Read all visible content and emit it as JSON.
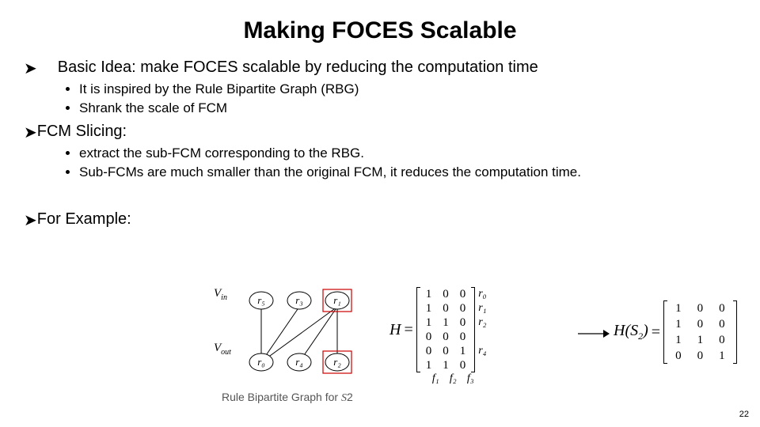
{
  "title": "Making FOCES Scalable",
  "bullets": {
    "b1": "Basic Idea: make FOCES scalable by reducing the computation time",
    "b1_sub": [
      "It is inspired by the Rule Bipartite Graph (RBG)",
      "Shrank the scale of FCM"
    ],
    "b2": "FCM Slicing:",
    "b2_sub": [
      "extract the sub-FCM corresponding to the RBG.",
      "Sub-FCMs are much smaller than the original FCM, it reduces the computation time."
    ],
    "b3": "For Example:"
  },
  "rbg": {
    "vin_label": "V",
    "vin_sub": "in",
    "vout_label": "V",
    "vout_sub": "out",
    "top_nodes": [
      "r₅",
      "r₃",
      "r₁"
    ],
    "bot_nodes": [
      "r₀",
      "r₄",
      "r₂"
    ],
    "caption_prefix": "Rule Bipartite Graph for ",
    "caption_sym": "S",
    "caption_sub": "2"
  },
  "matrixH": {
    "name": "H",
    "rows": [
      [
        1,
        0,
        0
      ],
      [
        1,
        0,
        0
      ],
      [
        1,
        1,
        0
      ],
      [
        0,
        0,
        0
      ],
      [
        0,
        0,
        1
      ],
      [
        1,
        1,
        0
      ]
    ],
    "row_labels": [
      "r₀",
      "r₁",
      "r₂",
      "",
      "r₄",
      ""
    ],
    "col_labels": [
      "f₁",
      "f₂",
      "f₃"
    ]
  },
  "matrixHS": {
    "name_prefix": "H(S",
    "name_sub": "2",
    "name_suffix": ")",
    "rows": [
      [
        1,
        0,
        0
      ],
      [
        1,
        0,
        0
      ],
      [
        1,
        1,
        0
      ],
      [
        0,
        0,
        1
      ]
    ]
  },
  "page_number": "22",
  "arrow_glyph": "➤",
  "chart_data": {
    "type": "diagram",
    "description": "Bipartite graph with top partition Vin={r5,r3,r1}, bottom partition Vout={r0,r4,r2}; edges r5-r0, r3-r0, r1-r0, r1-r4, r1-r2; r1 and r2 highlighted. Matrix H (6x3) with row labels r0..r5 (r3,r5 blank) over columns f1..f3; arrow to H(S2) a 4x3 submatrix."
  }
}
